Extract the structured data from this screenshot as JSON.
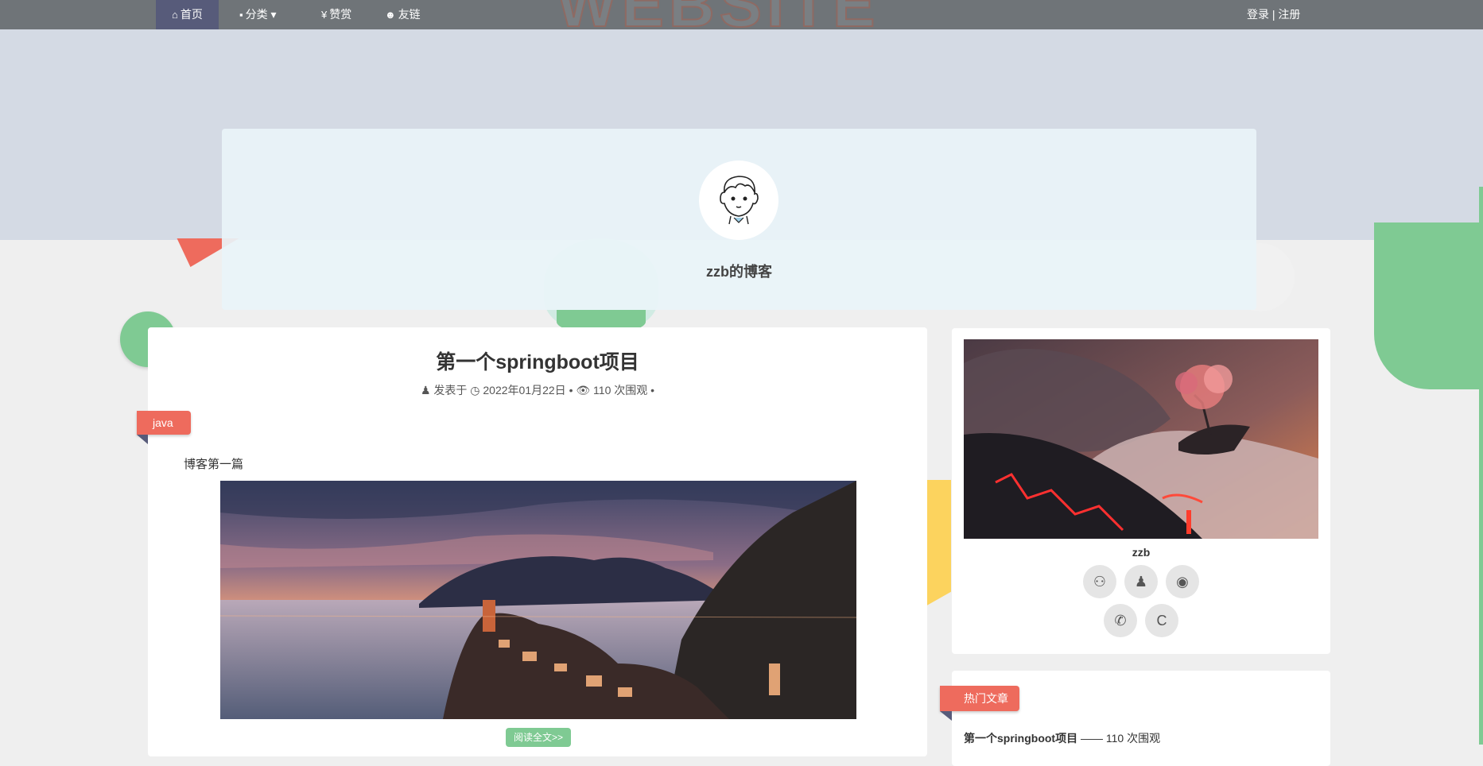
{
  "nav": {
    "watermark": "WEBSITE",
    "items": [
      {
        "icon": "⌂",
        "label": "首页"
      },
      {
        "icon": "▪",
        "label": "分类",
        "caret": "▾"
      },
      {
        "icon": "¥",
        "label": "赞赏"
      },
      {
        "icon": "☻",
        "label": "友链"
      }
    ],
    "login": "登录 | 注册"
  },
  "profile": {
    "blog_name": "zzb的博客"
  },
  "post": {
    "title": "第一个springboot项目",
    "meta_author": "发表于",
    "meta_date": "2022年01月22日",
    "meta_views": "110 次围观",
    "tag": "java",
    "excerpt": "博客第一篇",
    "read_more": "阅读全文>>"
  },
  "author": {
    "name": "zzb",
    "social": [
      {
        "name": "github-icon",
        "glyph": "⚇"
      },
      {
        "name": "qq-icon",
        "glyph": "♟"
      },
      {
        "name": "weibo-icon",
        "glyph": "◉"
      },
      {
        "name": "wechat-icon",
        "glyph": "✆"
      },
      {
        "name": "c-icon",
        "glyph": "C"
      }
    ]
  },
  "hot": {
    "tag": "热门文章",
    "items": [
      {
        "title": "第一个springboot项目",
        "sep": " —— ",
        "views": "110 次围观"
      }
    ]
  },
  "colors": {
    "accent_red": "#ee6b5d",
    "accent_green": "#7fca93",
    "nav": "#6f7478",
    "nav_active": "#575b7a"
  }
}
